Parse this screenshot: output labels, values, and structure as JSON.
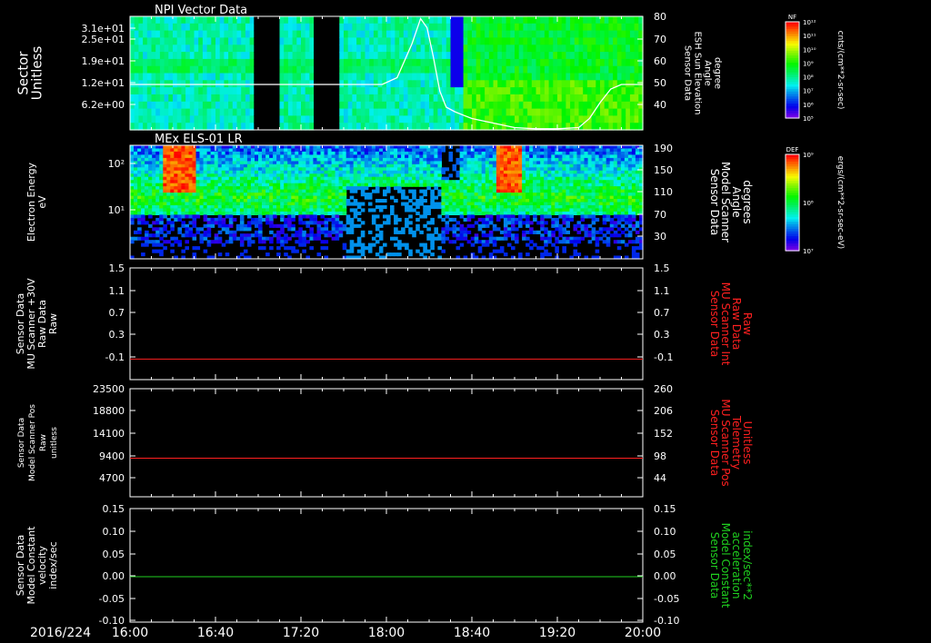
{
  "date_label": "2016/224",
  "time_ticks": [
    "16:00",
    "16:40",
    "17:20",
    "18:00",
    "18:40",
    "19:20",
    "20:00"
  ],
  "colorbars": [
    {
      "title": "NF",
      "ticks": [
        "10¹²",
        "10¹¹",
        "10¹⁰",
        "10⁹",
        "10⁸",
        "10⁷",
        "10⁶",
        "10⁵"
      ],
      "unit": "cnts/(cm**2-sr-sec)"
    },
    {
      "title": "DEF",
      "ticks": [
        "10⁹",
        "10⁸",
        "10⁷"
      ],
      "unit": "ergs/(cm**2-sr-sec-eV)"
    }
  ],
  "colors": {
    "white": "#ffffff",
    "red": "#ff2020",
    "green": "#20d020"
  },
  "chart_data": [
    {
      "type": "heatmap",
      "title": "NPI Vector Data",
      "ylabel": "Sector Unitless",
      "y_ticks": [
        "3.1e+01",
        "2.5e+01",
        "1.9e+01",
        "1.2e+01",
        "6.2e+00"
      ],
      "y2label": "Sensor Data ESH Sun Elevation Angle degree",
      "y2_ticks": [
        "80",
        "70",
        "60",
        "50",
        "40"
      ],
      "y2lim": [
        30,
        80
      ],
      "line_series": {
        "name": "ESH Sun Elevation Angle",
        "color": "#ffffff",
        "x": [
          "16:00",
          "17:58",
          "18:05",
          "18:12",
          "18:16",
          "18:19",
          "18:22",
          "18:25",
          "18:28",
          "18:32",
          "18:36",
          "18:40",
          "18:50",
          "19:00",
          "19:10",
          "19:20",
          "19:30",
          "19:35",
          "19:40",
          "19:45",
          "19:50",
          "20:00"
        ],
        "y": [
          50,
          50,
          53,
          68,
          79,
          75,
          62,
          47,
          40,
          38,
          36.5,
          35,
          33,
          31,
          30.5,
          30.5,
          31,
          35,
          42,
          48,
          50,
          50
        ]
      },
      "heatmap": "counts vs sector and time; data gaps 16:58-17:10 and 17:25-17:37"
    },
    {
      "type": "heatmap",
      "title": "MEx ELS-01 LR",
      "ylabel": "Electron Energy eV",
      "y_ticks": [
        "10²",
        "10¹"
      ],
      "y2label": "Sensor Data Model Scanner Angle degrees",
      "y2_ticks": [
        "190",
        "150",
        "110",
        "70",
        "30"
      ],
      "heatmap": "differential energy flux vs energy and time; intense bursts near 16:20 and 18:55"
    },
    {
      "type": "line",
      "ylabel": "Sensor Data MU Scanner +30V Raw Data Raw",
      "y_ticks": [
        "1.5",
        "1.1",
        "0.7",
        "0.3",
        "-0.1"
      ],
      "ylim": [
        -0.4,
        1.5
      ],
      "y2label": "Sensor Data MU Scanner Int Raw Data Raw",
      "y2_ticks": [
        "1.5",
        "1.1",
        "0.7",
        "0.3",
        "-0.1"
      ],
      "series": [
        {
          "color": "#ff2020",
          "x": [
            "16:00",
            "20:00"
          ],
          "y": [
            -0.05,
            -0.05
          ]
        }
      ]
    },
    {
      "type": "line",
      "ylabel": "Sensor Data Model Scanner Pos Raw unitless",
      "y_ticks": [
        "23500",
        "18800",
        "14100",
        "9400",
        "4700"
      ],
      "ylim": [
        0,
        23500
      ],
      "y2label": "Sensor Data MU Scanner Pos Telemetry Unitless",
      "y2_ticks": [
        "260",
        "206",
        "152",
        "98",
        "44"
      ],
      "series": [
        {
          "color": "#ff2020",
          "x": [
            "16:00",
            "20:00"
          ],
          "y": [
            8400,
            8400
          ]
        }
      ]
    },
    {
      "type": "line",
      "ylabel": "Sensor Data Model Constant velocity index/sec",
      "y_ticks": [
        "0.15",
        "0.10",
        "0.05",
        "0.00",
        "-0.05",
        "-0.10"
      ],
      "ylim": [
        -0.1,
        0.15
      ],
      "y2label": "Sensor Data Model Constant acceleration index/sec**2",
      "y2_ticks": [
        "0.15",
        "0.10",
        "0.05",
        "0.00",
        "-0.05",
        "-0.10"
      ],
      "series": [
        {
          "color": "#20d020",
          "x": [
            "16:00",
            "20:00"
          ],
          "y": [
            0.0,
            0.0
          ]
        }
      ]
    }
  ]
}
